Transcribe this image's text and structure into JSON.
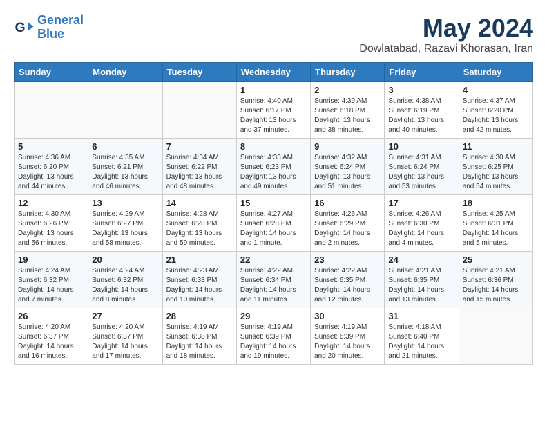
{
  "header": {
    "logo_line1": "General",
    "logo_line2": "Blue",
    "month": "May 2024",
    "location": "Dowlatabad, Razavi Khorasan, Iran"
  },
  "weekdays": [
    "Sunday",
    "Monday",
    "Tuesday",
    "Wednesday",
    "Thursday",
    "Friday",
    "Saturday"
  ],
  "weeks": [
    [
      {
        "day": "",
        "info": ""
      },
      {
        "day": "",
        "info": ""
      },
      {
        "day": "",
        "info": ""
      },
      {
        "day": "1",
        "info": "Sunrise: 4:40 AM\nSunset: 6:17 PM\nDaylight: 13 hours and 37 minutes."
      },
      {
        "day": "2",
        "info": "Sunrise: 4:39 AM\nSunset: 6:18 PM\nDaylight: 13 hours and 38 minutes."
      },
      {
        "day": "3",
        "info": "Sunrise: 4:38 AM\nSunset: 6:19 PM\nDaylight: 13 hours and 40 minutes."
      },
      {
        "day": "4",
        "info": "Sunrise: 4:37 AM\nSunset: 6:20 PM\nDaylight: 13 hours and 42 minutes."
      }
    ],
    [
      {
        "day": "5",
        "info": "Sunrise: 4:36 AM\nSunset: 6:20 PM\nDaylight: 13 hours and 44 minutes."
      },
      {
        "day": "6",
        "info": "Sunrise: 4:35 AM\nSunset: 6:21 PM\nDaylight: 13 hours and 46 minutes."
      },
      {
        "day": "7",
        "info": "Sunrise: 4:34 AM\nSunset: 6:22 PM\nDaylight: 13 hours and 48 minutes."
      },
      {
        "day": "8",
        "info": "Sunrise: 4:33 AM\nSunset: 6:23 PM\nDaylight: 13 hours and 49 minutes."
      },
      {
        "day": "9",
        "info": "Sunrise: 4:32 AM\nSunset: 6:24 PM\nDaylight: 13 hours and 51 minutes."
      },
      {
        "day": "10",
        "info": "Sunrise: 4:31 AM\nSunset: 6:24 PM\nDaylight: 13 hours and 53 minutes."
      },
      {
        "day": "11",
        "info": "Sunrise: 4:30 AM\nSunset: 6:25 PM\nDaylight: 13 hours and 54 minutes."
      }
    ],
    [
      {
        "day": "12",
        "info": "Sunrise: 4:30 AM\nSunset: 6:26 PM\nDaylight: 13 hours and 56 minutes."
      },
      {
        "day": "13",
        "info": "Sunrise: 4:29 AM\nSunset: 6:27 PM\nDaylight: 13 hours and 58 minutes."
      },
      {
        "day": "14",
        "info": "Sunrise: 4:28 AM\nSunset: 6:28 PM\nDaylight: 13 hours and 59 minutes."
      },
      {
        "day": "15",
        "info": "Sunrise: 4:27 AM\nSunset: 6:28 PM\nDaylight: 14 hours and 1 minute."
      },
      {
        "day": "16",
        "info": "Sunrise: 4:26 AM\nSunset: 6:29 PM\nDaylight: 14 hours and 2 minutes."
      },
      {
        "day": "17",
        "info": "Sunrise: 4:26 AM\nSunset: 6:30 PM\nDaylight: 14 hours and 4 minutes."
      },
      {
        "day": "18",
        "info": "Sunrise: 4:25 AM\nSunset: 6:31 PM\nDaylight: 14 hours and 5 minutes."
      }
    ],
    [
      {
        "day": "19",
        "info": "Sunrise: 4:24 AM\nSunset: 6:32 PM\nDaylight: 14 hours and 7 minutes."
      },
      {
        "day": "20",
        "info": "Sunrise: 4:24 AM\nSunset: 6:32 PM\nDaylight: 14 hours and 8 minutes."
      },
      {
        "day": "21",
        "info": "Sunrise: 4:23 AM\nSunset: 6:33 PM\nDaylight: 14 hours and 10 minutes."
      },
      {
        "day": "22",
        "info": "Sunrise: 4:22 AM\nSunset: 6:34 PM\nDaylight: 14 hours and 11 minutes."
      },
      {
        "day": "23",
        "info": "Sunrise: 4:22 AM\nSunset: 6:35 PM\nDaylight: 14 hours and 12 minutes."
      },
      {
        "day": "24",
        "info": "Sunrise: 4:21 AM\nSunset: 6:35 PM\nDaylight: 14 hours and 13 minutes."
      },
      {
        "day": "25",
        "info": "Sunrise: 4:21 AM\nSunset: 6:36 PM\nDaylight: 14 hours and 15 minutes."
      }
    ],
    [
      {
        "day": "26",
        "info": "Sunrise: 4:20 AM\nSunset: 6:37 PM\nDaylight: 14 hours and 16 minutes."
      },
      {
        "day": "27",
        "info": "Sunrise: 4:20 AM\nSunset: 6:37 PM\nDaylight: 14 hours and 17 minutes."
      },
      {
        "day": "28",
        "info": "Sunrise: 4:19 AM\nSunset: 6:38 PM\nDaylight: 14 hours and 18 minutes."
      },
      {
        "day": "29",
        "info": "Sunrise: 4:19 AM\nSunset: 6:39 PM\nDaylight: 14 hours and 19 minutes."
      },
      {
        "day": "30",
        "info": "Sunrise: 4:19 AM\nSunset: 6:39 PM\nDaylight: 14 hours and 20 minutes."
      },
      {
        "day": "31",
        "info": "Sunrise: 4:18 AM\nSunset: 6:40 PM\nDaylight: 14 hours and 21 minutes."
      },
      {
        "day": "",
        "info": ""
      }
    ]
  ]
}
